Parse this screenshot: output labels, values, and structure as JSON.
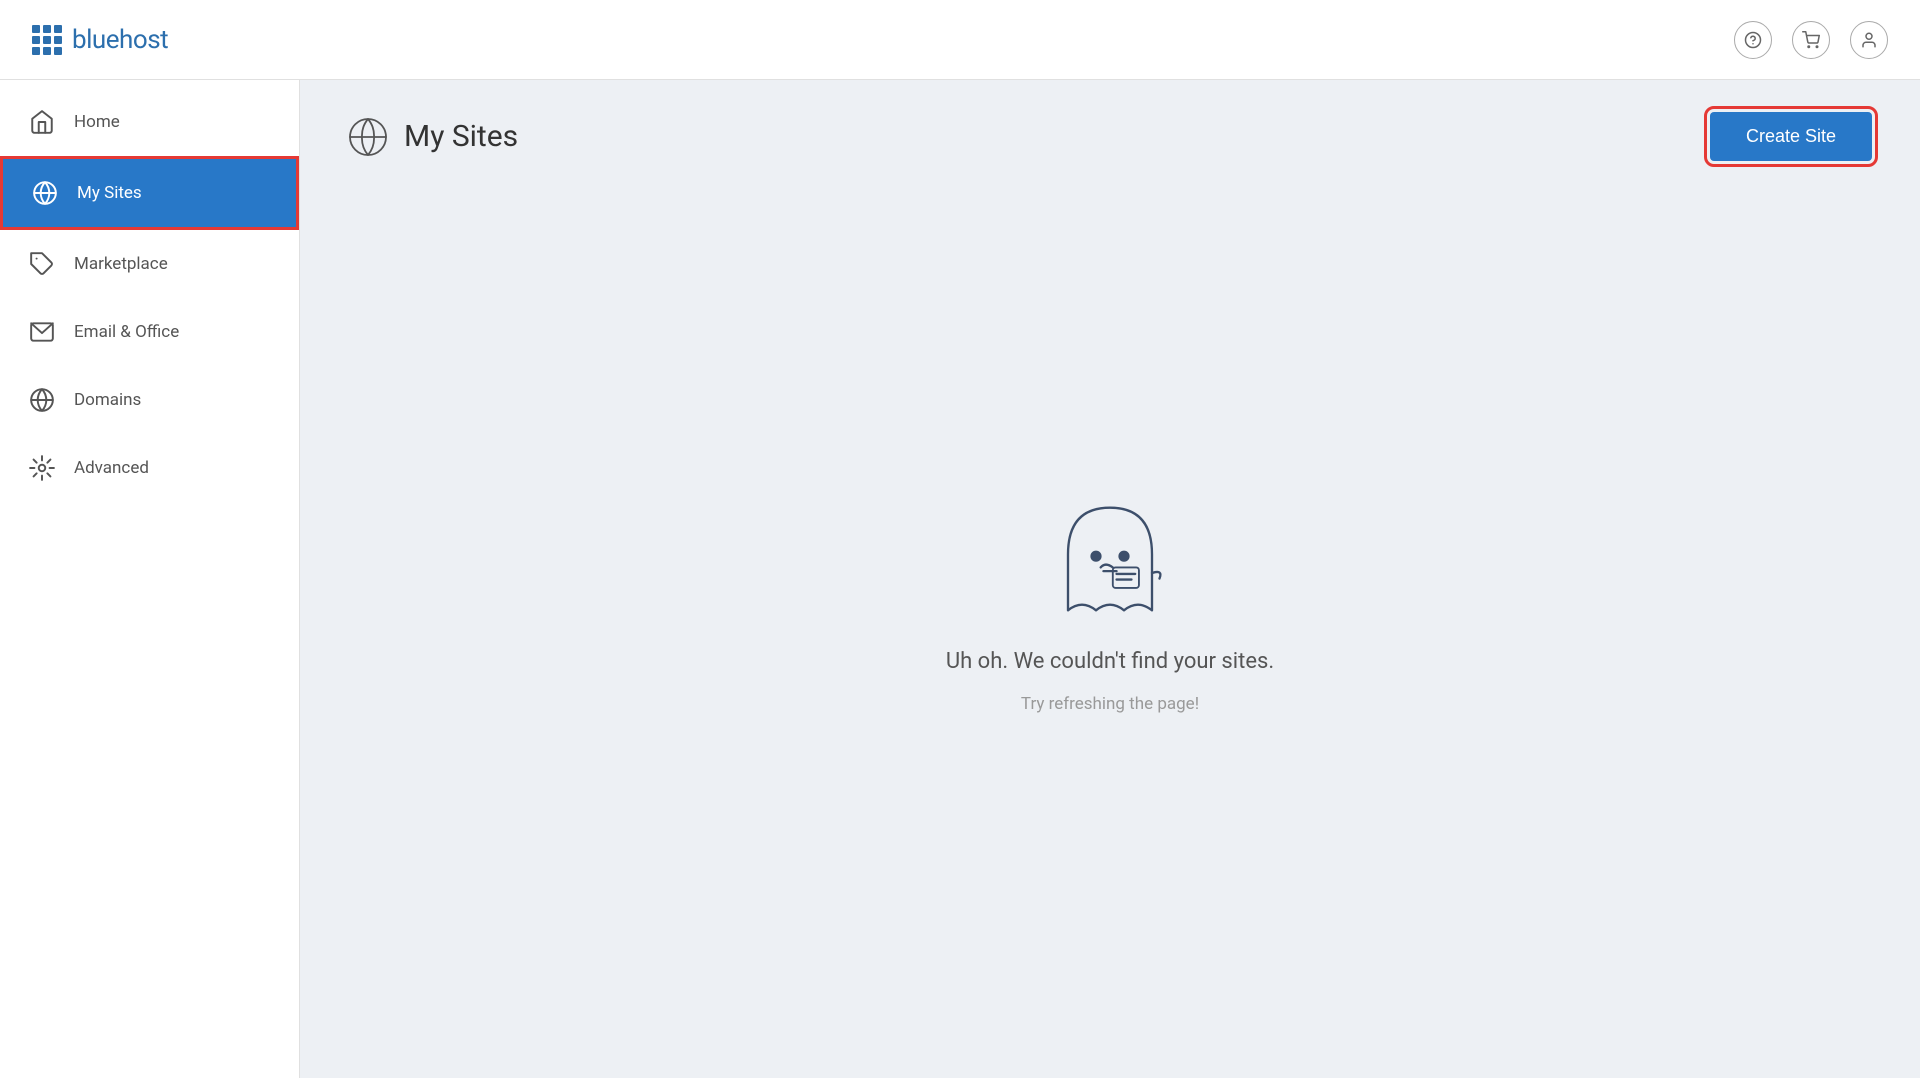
{
  "header": {
    "logo_text": "bluehost",
    "icons": {
      "help": "?",
      "cart": "cart-icon",
      "user": "user-icon"
    }
  },
  "sidebar": {
    "items": [
      {
        "id": "home",
        "label": "Home",
        "active": false
      },
      {
        "id": "my-sites",
        "label": "My Sites",
        "active": true
      },
      {
        "id": "marketplace",
        "label": "Marketplace",
        "active": false
      },
      {
        "id": "email-office",
        "label": "Email & Office",
        "active": false
      },
      {
        "id": "domains",
        "label": "Domains",
        "active": false
      },
      {
        "id": "advanced",
        "label": "Advanced",
        "active": false
      }
    ]
  },
  "main": {
    "page_title": "My Sites",
    "create_button_label": "Create Site",
    "empty_state": {
      "title": "Uh oh. We couldn't find your sites.",
      "subtitle": "Try refreshing the page!"
    }
  }
}
